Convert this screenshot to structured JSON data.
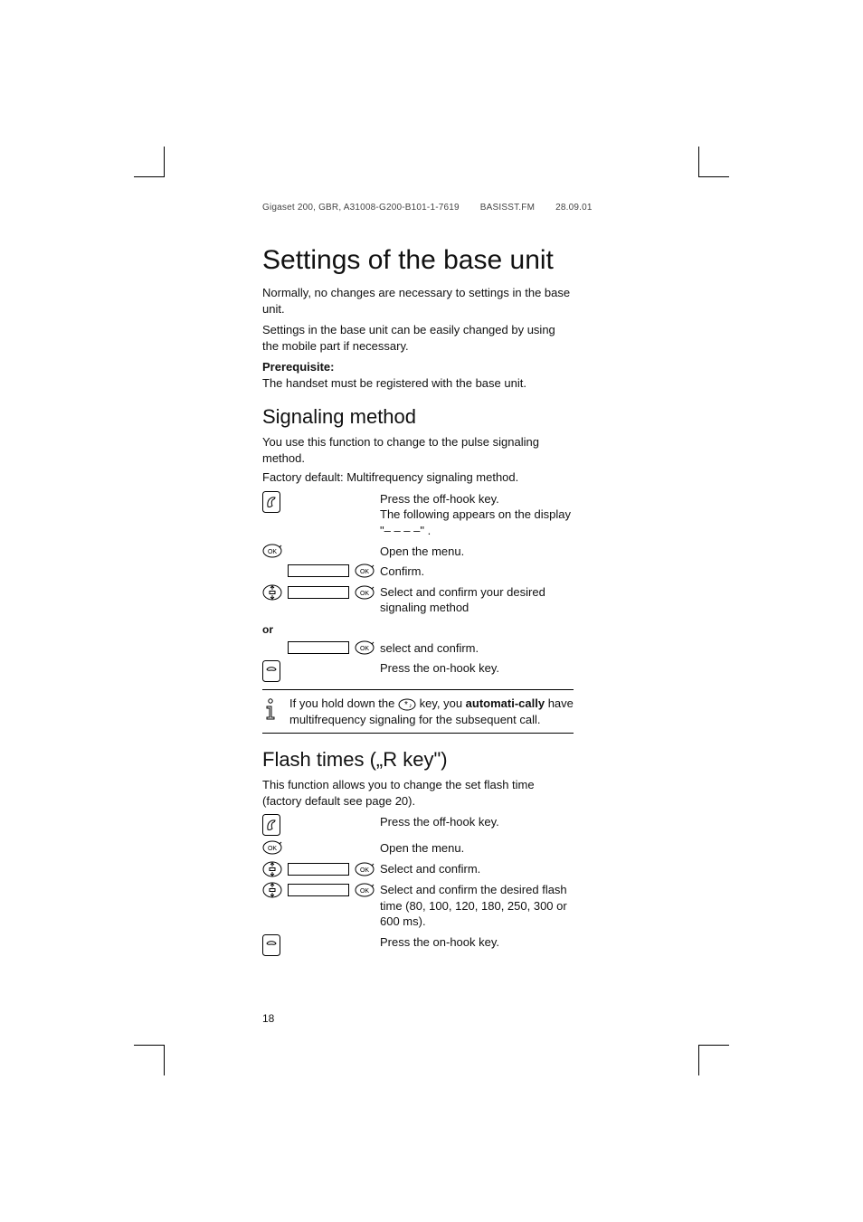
{
  "footer_header": {
    "doc_id": "Gigaset 200, GBR, A31008-G200-B101-1-7619",
    "file": "BASISST.FM",
    "date": "28.09.01"
  },
  "title": "Settings of the base unit",
  "intro_1": "Normally, no changes are necessary to settings in the base unit.",
  "intro_2": "Settings in the base unit can be easily changed by using the mobile part if necessary.",
  "prereq_label": "Prerequisite:",
  "prereq_text": "The handset must be registered with the base unit.",
  "section_signal": "Signaling method",
  "signal_intro_1": "You use this function to change to the pulse signaling method.",
  "signal_intro_2": "Factory default: Multifrequency signaling method.",
  "steps": {
    "press_offhook_a": "Press the off-hook key.",
    "press_offhook_b": "The following appears on the display  \"– – – –\"  .",
    "open_menu": "Open the menu.",
    "confirm": "Confirm.",
    "select_signal": "Select and confirm your desired signaling method",
    "or_label": "or",
    "select_and_confirm": "select and confirm.",
    "press_onhook": "Press the on-hook key."
  },
  "info": {
    "before_bold": "If you hold down the ",
    "after_key": " key, you ",
    "auto_word": "automati-cally",
    "rest": " have multifrequency signaling for the subsequent call."
  },
  "section_flash": "Flash times („R key\")",
  "flash_intro": "This function allows you to change the set flash time (factory default see page 20).",
  "flash_steps": {
    "press_offhook": "Press the off-hook key.",
    "open_menu": "Open the menu.",
    "select_confirm": "Select and confirm.",
    "select_time": "Select and confirm the desired flash time (80, 100, 120, 180, 250, 300 or 600 ms).",
    "press_onhook": "Press the on-hook key."
  },
  "page_number": "18"
}
